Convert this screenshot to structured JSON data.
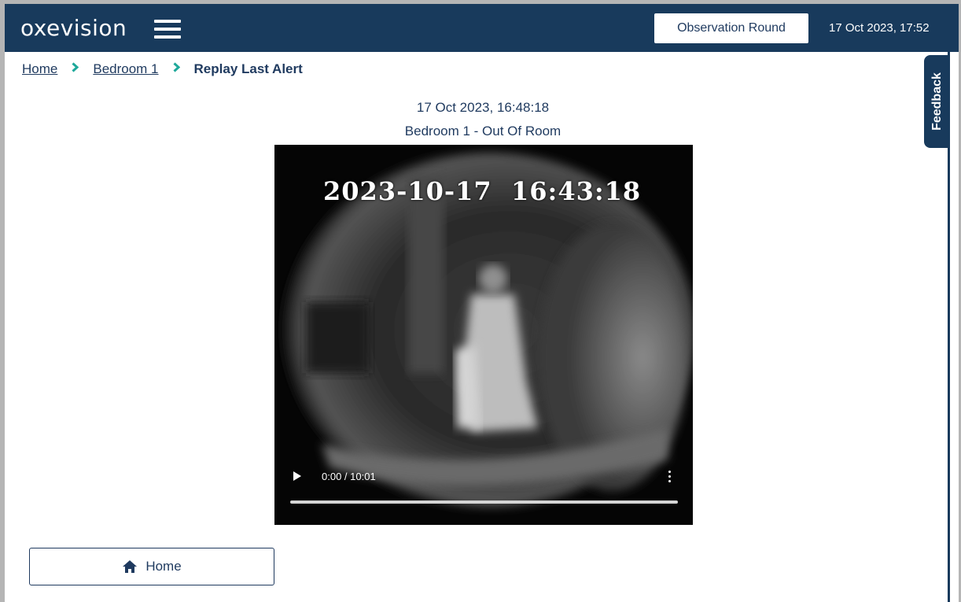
{
  "header": {
    "logo_text": "oxevision",
    "observation_round_label": "Observation Round",
    "current_datetime": "17 Oct 2023, 17:52"
  },
  "breadcrumb": {
    "items": [
      {
        "label": "Home"
      },
      {
        "label": "Bedroom 1"
      }
    ],
    "current": "Replay Last Alert"
  },
  "alert": {
    "datetime": "17 Oct 2023, 16:48:18",
    "title": "Bedroom 1 - Out Of Room"
  },
  "video": {
    "timestamp_overlay": "2023-10-17  16:43:18",
    "time_display": "0:00 / 10:01",
    "progress_fraction": 0
  },
  "home_button_label": "Home",
  "feedback_label": "Feedback",
  "colors": {
    "navy": "#183a5c",
    "text": "#1f3a5f",
    "accent": "#1ea89a"
  },
  "icons": [
    "hamburger-icon",
    "chevron-right-icon",
    "play-icon",
    "more-vert-icon",
    "home-icon"
  ]
}
